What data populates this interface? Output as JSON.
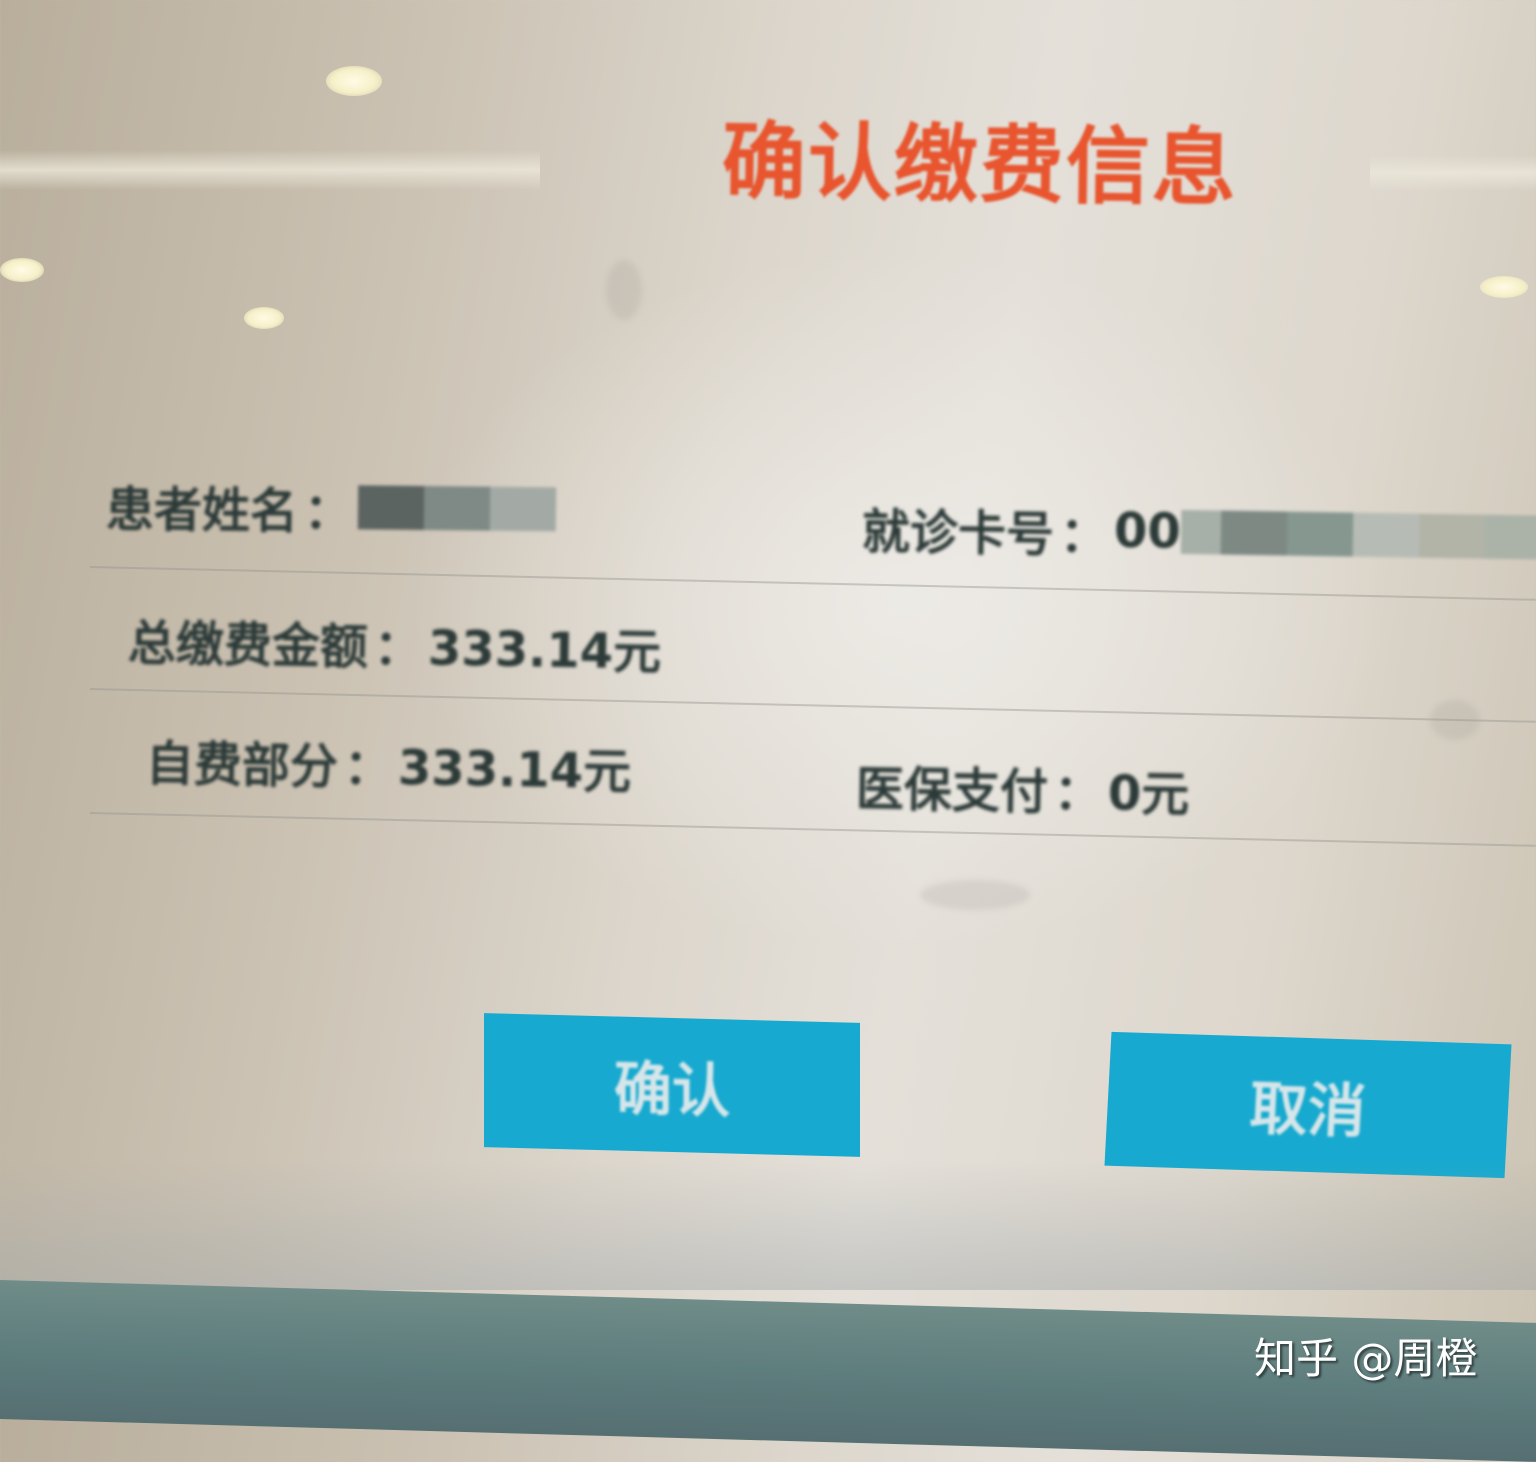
{
  "dialog": {
    "title": "确认缴费信息",
    "fields": {
      "patient_name": {
        "label": "患者姓名",
        "separator": "：",
        "value_prefix": "",
        "redacted": true
      },
      "card_number": {
        "label": "就诊卡号",
        "separator": "：",
        "value_prefix": "00",
        "redacted": true
      },
      "total_amount": {
        "label": "总缴费金额",
        "separator": "：",
        "value": "333.14元"
      },
      "self_pay": {
        "label": "自费部分",
        "separator": "：",
        "value": "333.14元"
      },
      "insurance_pay": {
        "label": "医保支付",
        "separator": "：",
        "value": "0元"
      }
    },
    "buttons": {
      "confirm": "确认",
      "cancel": "取消"
    }
  },
  "colors": {
    "title": "#e8552e",
    "button": "#17a9cf",
    "text": "#2c3a38"
  },
  "watermark": "知乎 @周橙"
}
